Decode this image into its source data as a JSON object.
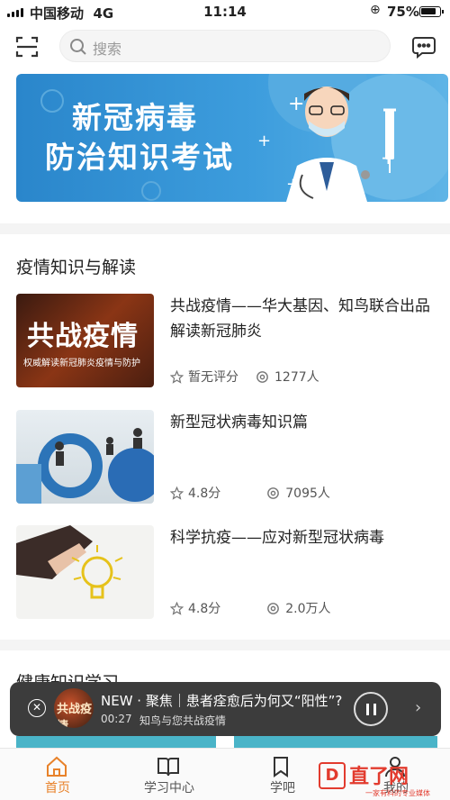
{
  "status_bar": {
    "carrier": "中国移动",
    "network": "4G",
    "time": "11:14",
    "battery": "75%"
  },
  "header": {
    "search_placeholder": "搜索",
    "scan_icon": "scan-icon",
    "message_icon": "message-icon"
  },
  "banner": {
    "line1": "新冠病毒",
    "line2": "防治知识考试"
  },
  "section1": {
    "title": "疫情知识与解读",
    "courses": [
      {
        "title": "共战疫情——华大基因、知鸟联合出品解读新冠肺炎",
        "rating": "暂无评分",
        "views": "1277人",
        "thumb_text": "共战疫情",
        "thumb_sub": "权威解读新冠肺炎疫情与防护"
      },
      {
        "title": "新型冠状病毒知识篇",
        "rating": "4.8分",
        "views": "7095人"
      },
      {
        "title": "科学抗疫——应对新型冠状病毒",
        "rating": "4.8分",
        "views": "2.0万人"
      }
    ]
  },
  "section2": {
    "title": "健康知识学习"
  },
  "player": {
    "title": "NEW · 聚焦｜患者痊愈后为何又“阳性”?",
    "time": "00:27",
    "subtitle": "知鸟与您共战疫情",
    "cover_text": "共战疫情"
  },
  "tabs": [
    {
      "label": "首页",
      "icon": "home-icon"
    },
    {
      "label": "学习中心",
      "icon": "book-icon"
    },
    {
      "label": "学吧",
      "icon": "bookmark-icon"
    },
    {
      "label": "我的",
      "icon": "user-icon"
    }
  ],
  "watermark": {
    "logo": "D",
    "name": "直了网",
    "sub": "一家有料的专业媒体"
  },
  "colors": {
    "accent": "#e8822a",
    "banner_blue": "#2a86cb",
    "player_bg": "#3c3c3c"
  }
}
